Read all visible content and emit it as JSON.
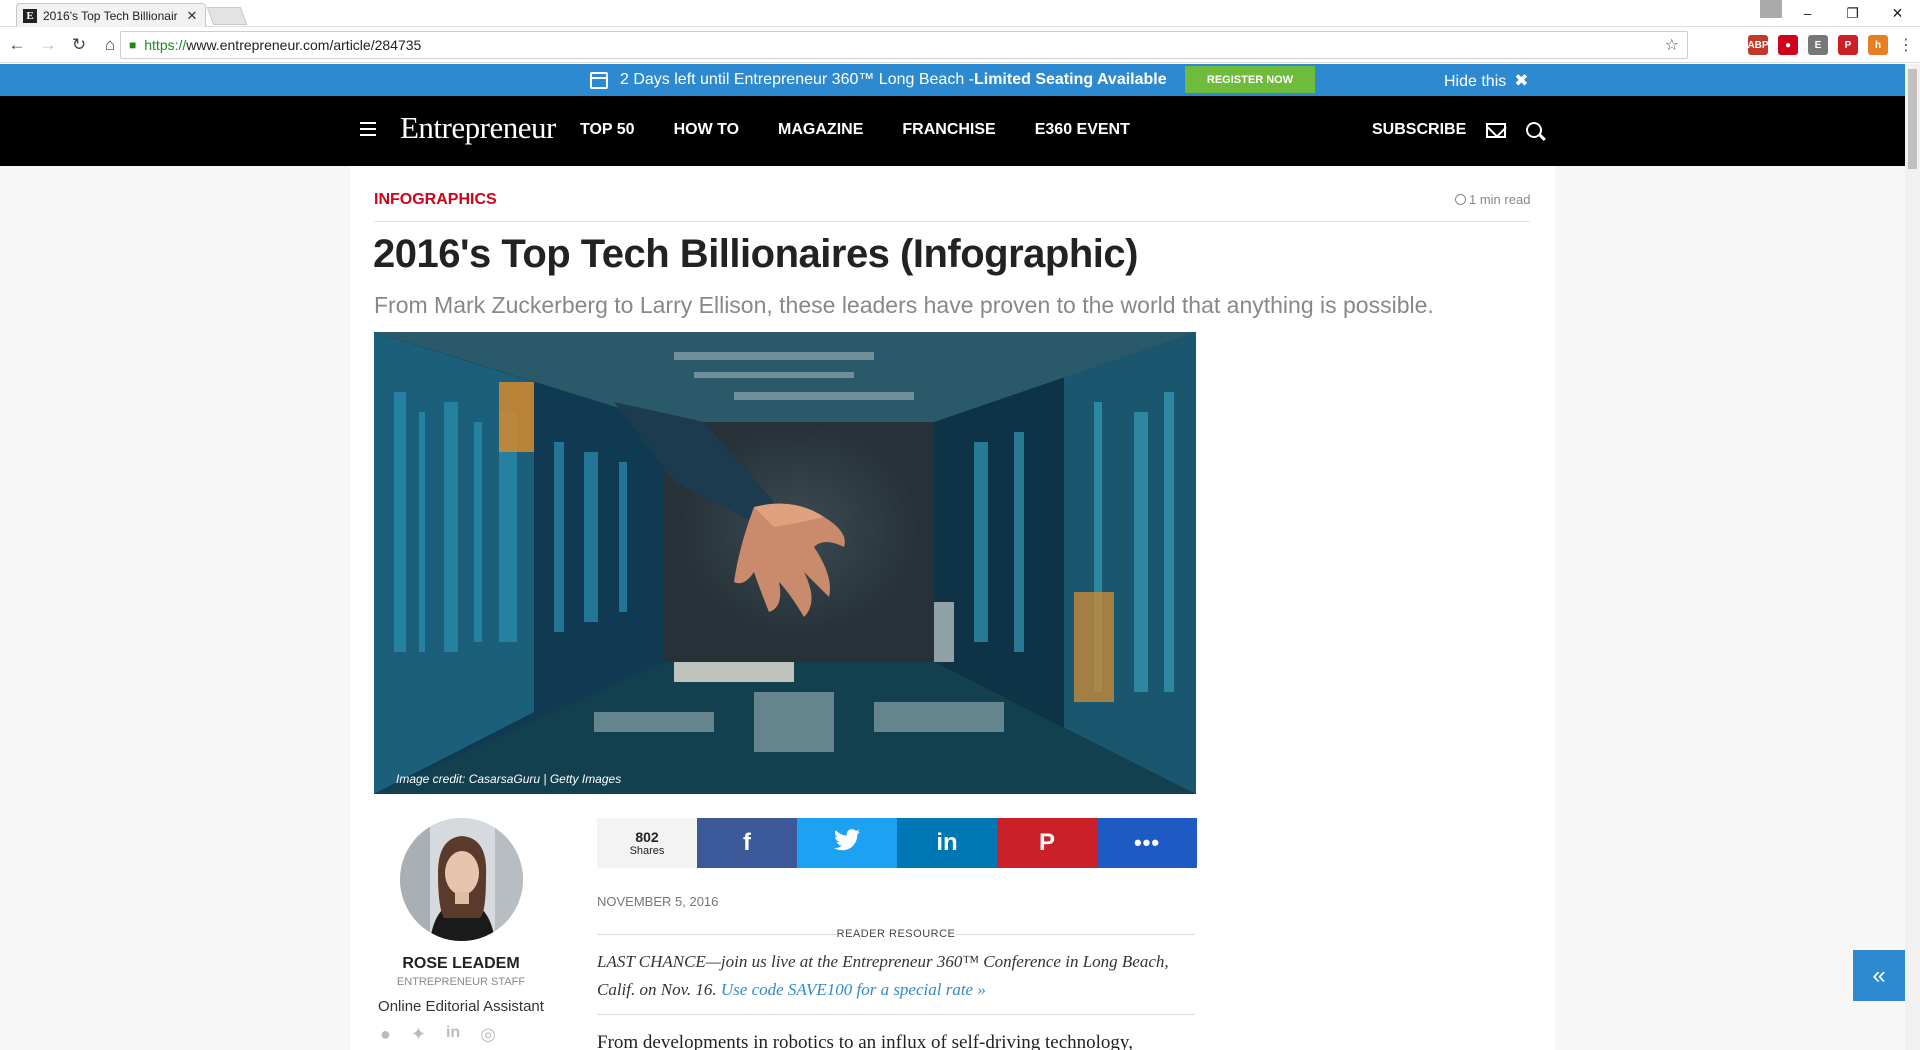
{
  "browser": {
    "tab_title": "2016's Top Tech Billionair",
    "tab_favicon": "E",
    "url_proto": "https://",
    "url_rest": "www.entrepreneur.com/article/284735",
    "window_controls": [
      "–",
      "❐",
      "✕"
    ],
    "extensions": [
      {
        "icon": "adblock-icon",
        "label": "ABP",
        "color": "#c0392b"
      },
      {
        "icon": "lastpass-icon",
        "label": "●",
        "color": "#d0021b"
      },
      {
        "icon": "bookmark-ext-icon",
        "label": "E",
        "color": "#777777"
      },
      {
        "icon": "pinterest-ext-icon",
        "label": "P",
        "color": "#cb2027"
      },
      {
        "icon": "honey-ext-icon",
        "label": "h",
        "color": "#e67e22"
      }
    ]
  },
  "promo": {
    "text_main": "2 Days left until Entrepreneur 360™ Long Beach - ",
    "text_bold": "Limited Seating Available",
    "register_label": "REGISTER NOW",
    "hide_label": "Hide this",
    "hide_icon": "✖"
  },
  "nav": {
    "logo": "Entrepreneur",
    "links": [
      "TOP 50",
      "HOW TO",
      "MAGAZINE",
      "FRANCHISE",
      "E360 EVENT"
    ],
    "subscribe": "SUBSCRIBE"
  },
  "article": {
    "category": "INFOGRAPHICS",
    "read_time": "1 min read",
    "headline": "2016's Top Tech Billionaires (Infographic)",
    "subhead": "From Mark Zuckerberg to Larry Ellison, these leaders have proven to the world that anything is possible.",
    "image_credit": "Image credit: CasarsaGuru | Getty Images",
    "date": "NOVEMBER 5, 2016",
    "reader_resource": "READER RESOURCE",
    "promo_text": "LAST CHANCE—join us live at the Entrepreneur 360™ Conference in Long Beach, Calif. on Nov. 16. ",
    "promo_link": "Use code SAVE100 for a special rate »",
    "body_start": "From developments in robotics to an influx of self-driving technology,"
  },
  "author": {
    "name": "ROSE LEADEM",
    "role": "ENTREPRENEUR STAFF",
    "title": "Online Editorial Assistant"
  },
  "share": {
    "count": "802",
    "count_label": "Shares",
    "buttons": [
      "f",
      "t",
      "in",
      "P",
      "•••"
    ]
  },
  "colors": {
    "brand_blue": "#2e8ad0",
    "category_red": "#d0021b",
    "register_green": "#6fbb3b"
  }
}
